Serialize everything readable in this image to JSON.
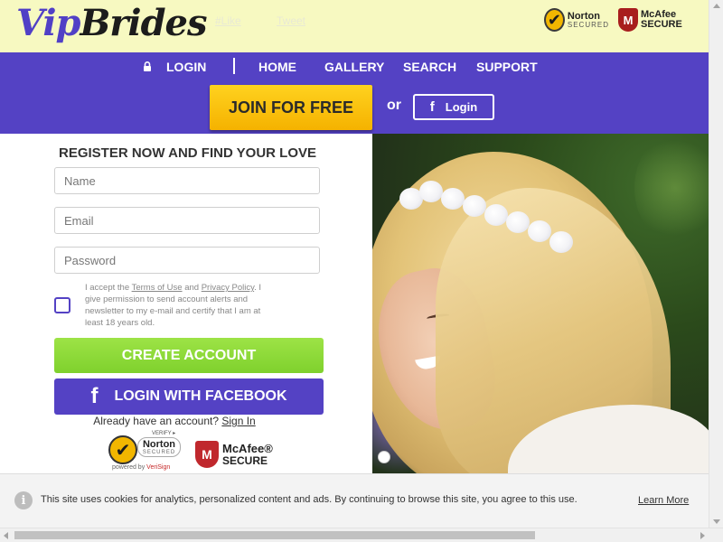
{
  "header": {
    "logo_part1": "Vip",
    "logo_part2": "Brides",
    "social_links": [
      "#Like",
      "Tweet"
    ],
    "norton": {
      "check_icon": "✔",
      "name": "Norton",
      "sub": "SECURED"
    },
    "mcafee": {
      "shield_letter": "M",
      "name": "McAfee",
      "sub": "SECURE"
    }
  },
  "nav": {
    "login_label": "LOGIN",
    "items": [
      "HOME",
      "GALLERY",
      "SEARCH",
      "SUPPORT"
    ],
    "join_label": "JOIN FOR FREE",
    "or_label": "or",
    "fb_login_label": "Login",
    "fb_icon": "f"
  },
  "form": {
    "title": "REGISTER NOW AND FIND YOUR LOVE",
    "fields": [
      {
        "placeholder": "Name",
        "value": ""
      },
      {
        "placeholder": "Email",
        "value": ""
      },
      {
        "placeholder": "Password",
        "value": ""
      }
    ],
    "consent": {
      "part1": "I accept the ",
      "terms": "Terms of Use",
      "and": " and ",
      "privacy": "Privacy Policy",
      "part2": ". I give permission to send account alerts and newsletter to my e-mail and certify that I am at least 18 years old.",
      "checked": false
    },
    "create_label": "CREATE ACCOUNT",
    "facebook_label": "LOGIN WITH FACEBOOK",
    "already_text": "Already have an account?",
    "signin_label": "Sign In"
  },
  "badges": {
    "verify": "VERIFY ▸",
    "norton_check": "✔",
    "norton_name": "Norton",
    "norton_sub": "SECURED",
    "powered_by": "powered by",
    "verisign": "VeriSign",
    "mcafee_letter": "M",
    "mcafee_name": "McAfee®",
    "mcafee_sub": "SECURE"
  },
  "cookie": {
    "info_icon": "i",
    "text": "This site uses cookies for analytics, personalized content and ads. By continuing to browse this site, you agree to this use.",
    "learn_more": "Learn More"
  },
  "icons": {
    "lock": "lock-icon",
    "facebook": "facebook-icon",
    "info": "info-icon"
  },
  "colors": {
    "brand_purple": "#5442c4",
    "header_yellow": "#f7f9c1",
    "join_yellow": "#ffd21f",
    "create_green": "#8ad936"
  }
}
